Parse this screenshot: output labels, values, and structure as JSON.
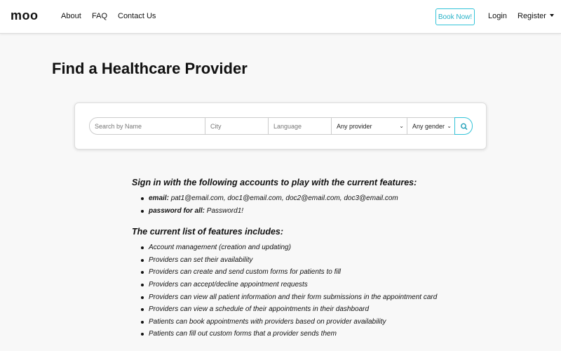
{
  "navbar": {
    "brand": "moo",
    "links": [
      "About",
      "FAQ",
      "Contact Us"
    ],
    "book_label": "Book Now!",
    "login_label": "Login",
    "register_label": "Register"
  },
  "page": {
    "title": "Find a Healthcare Provider"
  },
  "search": {
    "name_placeholder": "Search by Name",
    "city_placeholder": "City",
    "language_placeholder": "Language",
    "provider_select": "Any provider",
    "gender_select": "Any gender",
    "button_icon": "search-icon"
  },
  "info": {
    "accounts_heading": "Sign in with the following accounts to play with the current features:",
    "email_label": "email:",
    "email_value": "pat1@email.com, doc1@email.com, doc2@email.com, doc3@email.com",
    "password_label": "password for all:",
    "password_value": "Password1!",
    "features_heading": "The current list of features includes:",
    "features": [
      "Account management (creation and updating)",
      "Providers can set their availability",
      "Providers can create and send custom forms for patients to fill",
      "Providers can accept/decline appointment requests",
      "Providers can view all patient information and their form submissions in the appointment card",
      "Providers can view a schedule of their appointments in their dashboard",
      "Patients can book appointments with providers based on provider availability",
      "Patients can fill out custom forms that a provider sends them"
    ]
  },
  "colors": {
    "accent": "#33c3d8",
    "background": "#f8f8f8"
  }
}
